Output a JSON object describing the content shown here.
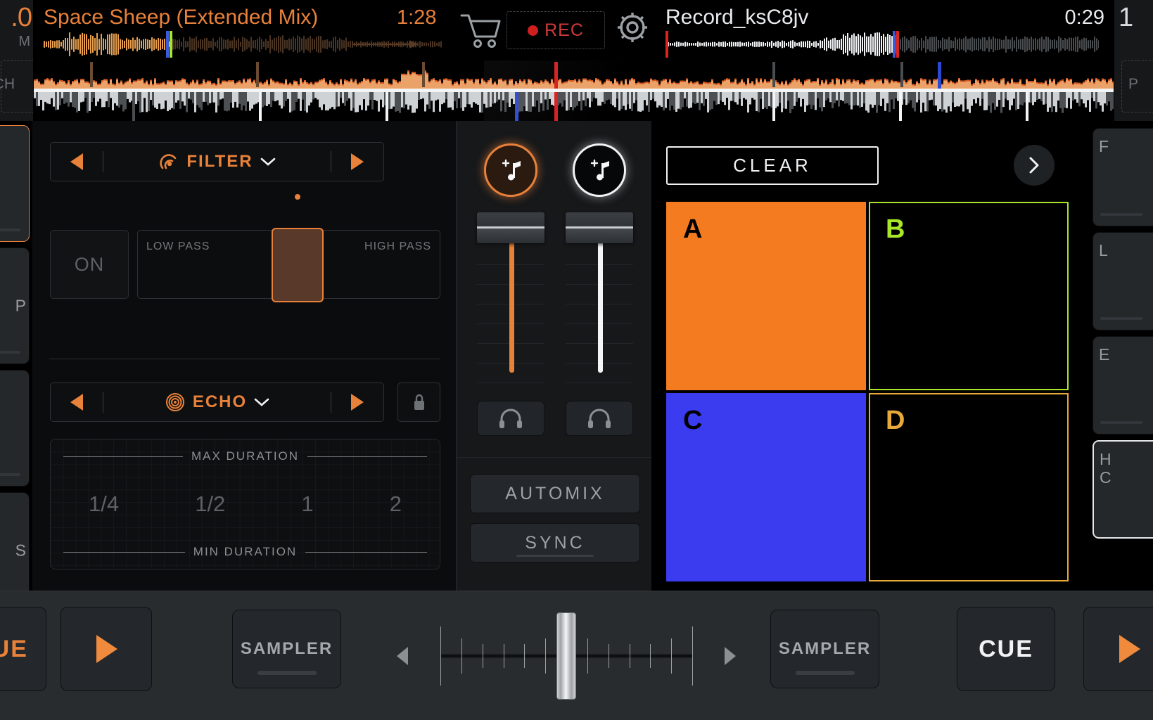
{
  "app": {
    "name": "dj-mixer"
  },
  "decks": {
    "a": {
      "title": "Space Sheep (Extended Mix)",
      "time": "1:28",
      "bpm_fragment": ".0",
      "bpm_label": "M",
      "pitch_label": "CH",
      "color": "#e8813a"
    },
    "b": {
      "title": "Record_ksC8jv",
      "time": "0:29",
      "bpm_fragment": "1",
      "pitch_label": "P",
      "color": "#f0f2f4"
    }
  },
  "topbar": {
    "cart_icon": "shopping-cart-icon",
    "rec_label": "REC",
    "gear_icon": "gear-icon"
  },
  "left_edge_buttons": [
    {
      "label": "",
      "active": true
    },
    {
      "label": "P",
      "active": false
    },
    {
      "label": "",
      "active": false
    },
    {
      "label": "S",
      "active": false
    }
  ],
  "right_edge_buttons": [
    {
      "label": "F",
      "hilite": false
    },
    {
      "label": "L",
      "hilite": false
    },
    {
      "label": "E",
      "hilite": false
    },
    {
      "label": "H\nC",
      "hilite": true
    }
  ],
  "fx": {
    "slot1": {
      "name": "FILTER",
      "icon": "filter-icon",
      "prev_icon": "arrow-left-icon",
      "next_icon": "arrow-right-icon",
      "chevron_icon": "chevron-down-icon",
      "on_label": "ON",
      "low_label": "LOW PASS",
      "high_label": "HIGH PASS",
      "slider_percent": 53
    },
    "slot2": {
      "name": "ECHO",
      "icon": "echo-target-icon",
      "prev_icon": "arrow-left-icon",
      "next_icon": "arrow-right-icon",
      "chevron_icon": "chevron-down-icon",
      "lock_icon": "lock-icon",
      "max_label": "MAX DURATION",
      "min_label": "MIN DURATION",
      "ticks": [
        "1/4",
        "1/2",
        "1",
        "2"
      ]
    }
  },
  "mixer": {
    "add_music_a_icon": "add-music-icon",
    "add_music_b_icon": "add-music-icon",
    "fader_a_percent": 12,
    "fader_b_percent": 12,
    "cue_a_icon": "headphones-icon",
    "cue_b_icon": "headphones-icon",
    "automix_label": "AUTOMIX",
    "sync_label": "SYNC"
  },
  "pads": {
    "clear_label": "CLEAR",
    "chevron_icon": "chevron-right-icon",
    "items": [
      {
        "label": "A",
        "fill": "#f47b20",
        "border": "#f47b20",
        "text": "#000000",
        "filled": true
      },
      {
        "label": "B",
        "fill": "#000000",
        "border": "#a8e62a",
        "text": "#a8e62a",
        "filled": false
      },
      {
        "label": "C",
        "fill": "#3b3bf0",
        "border": "#3b3bf0",
        "text": "#000000",
        "filled": true
      },
      {
        "label": "D",
        "fill": "#000000",
        "border": "#e8a93a",
        "text": "#e8a93a",
        "filled": false
      }
    ]
  },
  "transport": {
    "cue_left_label": "CUE",
    "play_left_icon": "play-icon",
    "sampler_left_label": "SAMPLER",
    "sampler_right_label": "SAMPLER",
    "cue_right_label": "CUE",
    "play_right_icon": "play-icon",
    "crossfader_percent": 50,
    "xf_prev_icon": "triangle-left-icon",
    "xf_next_icon": "triangle-right-icon"
  },
  "colors": {
    "deck_a_accent": "#e8813a",
    "deck_b_accent": "#f0f2f4",
    "rec_red": "#cf3a3a",
    "panel_bg": "#16181a",
    "bottom_bg": "#292c2f"
  }
}
